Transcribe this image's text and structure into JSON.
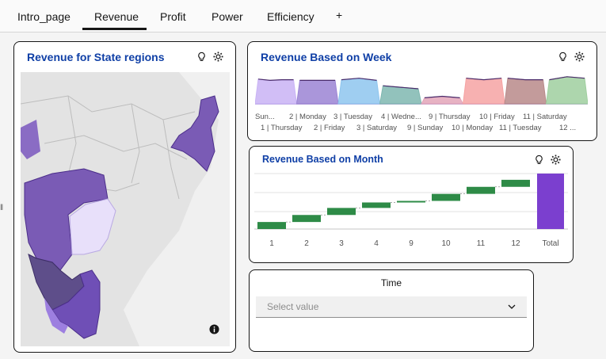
{
  "tabs": [
    {
      "label": "Intro_page"
    },
    {
      "label": "Revenue",
      "active": true
    },
    {
      "label": "Profit"
    },
    {
      "label": "Power"
    },
    {
      "label": "Efficiency"
    }
  ],
  "add_tab": "+",
  "map_card": {
    "title": "Revenue for State regions",
    "info_icon": "info-icon"
  },
  "week_card": {
    "title": "Revenue Based on Week",
    "row1": [
      "Sun...",
      "2 | Monday",
      "3 | Tuesday",
      "4 | Wedne...",
      "9 | Thursday",
      "10 | Friday",
      "11 | Saturday"
    ],
    "row2": [
      "1 | Thursday",
      "2 | Friday",
      "3 | Saturday",
      "9 | Sunday",
      "10 | Monday",
      "11 | Tuesday",
      "12 ..."
    ]
  },
  "month_card": {
    "title": "Revenue Based on  Month"
  },
  "time_card": {
    "label": "Time",
    "placeholder": "Select value"
  },
  "icons": {
    "idea": "lightbulb-icon",
    "settings": "gear-icon"
  },
  "colors": {
    "accent": "#0f3fa6",
    "waterfall_up": "#2e8b47",
    "waterfall_total": "#7b3fcf",
    "map_region": "#7a5bb5"
  },
  "chart_data": [
    {
      "type": "area",
      "title": "Revenue Based on Week",
      "x": [
        "Sun...",
        "1 | Thursday",
        "2 | Monday",
        "2 | Friday",
        "3 | Tuesday",
        "3 | Saturday",
        "4 | Wedne...",
        "9 | Sunday",
        "9 | Thursday",
        "10 | Monday",
        "10 | Friday",
        "11 | Tuesday",
        "11 | Saturday",
        "12 ..."
      ],
      "series": [
        {
          "color": "#c9b3f5",
          "values": [
            0.82,
            0.78,
            0.8,
            0.8
          ]
        },
        {
          "color": "#9b84d4",
          "values": [
            0.78,
            0.78,
            0.78
          ]
        },
        {
          "color": "#8ec5ee",
          "values": [
            0.8,
            0.85,
            0.78
          ]
        },
        {
          "color": "#7fb7b0",
          "values": [
            0.6,
            0.55,
            0.5
          ]
        },
        {
          "color": "#e3a4b8",
          "values": [
            0.2,
            0.25,
            0.2
          ]
        },
        {
          "color": "#f6a3a3",
          "values": [
            0.85,
            0.8,
            0.85
          ]
        },
        {
          "color": "#b88a8a",
          "values": [
            0.85,
            0.8,
            0.8
          ]
        },
        {
          "color": "#9fcf9f",
          "values": [
            0.8,
            0.9,
            0.85
          ]
        }
      ]
    },
    {
      "type": "bar",
      "subtype": "waterfall",
      "title": "Revenue Based on  Month",
      "categories": [
        "1",
        "2",
        "3",
        "4",
        "9",
        "10",
        "11",
        "12",
        "Total"
      ],
      "values": [
        9,
        9,
        9,
        7,
        2,
        9,
        9,
        9,
        71
      ]
    }
  ]
}
